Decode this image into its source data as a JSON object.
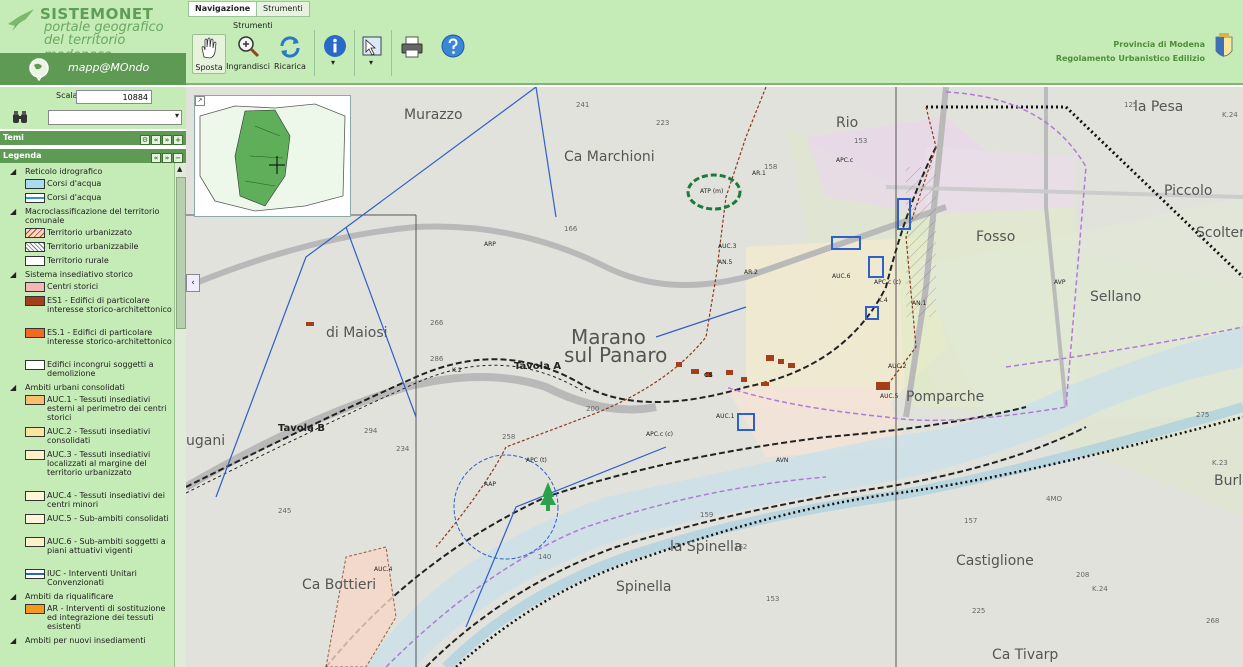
{
  "app": {
    "title": "SISTEMONET",
    "subtitle_line1": "portale geografico",
    "subtitle_line2": "del territorio modenese",
    "mappamondo": "mapp@MOndo"
  },
  "tabs": [
    {
      "label": "Navigazione",
      "active": true
    },
    {
      "label": "Strumenti",
      "active": false
    }
  ],
  "toolbar": {
    "group_label": "Strumenti",
    "sposta": "Sposta",
    "ingrandisci": "Ingrandisci",
    "ricarica": "Ricarica",
    "dropdown_arrow": "▾"
  },
  "province": {
    "line1": "Provincia di Modena",
    "line2": "Regolamento Urbanistico Edilizio"
  },
  "scale": {
    "label": "Scala",
    "value": "10884"
  },
  "panels": {
    "temi": "Temi",
    "legenda": "Legenda"
  },
  "legend": [
    {
      "type": "group",
      "label": "Reticolo idrografico"
    },
    {
      "type": "item",
      "label": "Corsi d'acqua",
      "fill": "#a9dcf0"
    },
    {
      "type": "item",
      "label": "Corsi d'acqua",
      "fill": "#ffffff",
      "line": "#3a8fd6"
    },
    {
      "type": "group",
      "label": "Macroclassificazione del territorio comunale"
    },
    {
      "type": "item",
      "label": "Territorio urbanizzato",
      "fill": "#f5d8c8",
      "pattern": "tri"
    },
    {
      "type": "item",
      "label": "Territorio urbanizzabile",
      "fill": "#ffffff",
      "pattern": "hatch"
    },
    {
      "type": "item",
      "label": "Territorio rurale",
      "fill": "#ffffff"
    },
    {
      "type": "group",
      "label": "Sistema insediativo storico"
    },
    {
      "type": "item",
      "label": "Centri storici",
      "fill": "#f5b6b6"
    },
    {
      "type": "item",
      "label": "ES1 - Edifici di particolare interesse storico-architettonico",
      "fill": "#a33f1a"
    },
    {
      "type": "item",
      "label": "ES.1 - Edifici di particolare interesse storico-architettonico",
      "fill": "#f26a21"
    },
    {
      "type": "item",
      "label": "Edifici incongrui soggetti a demolizione",
      "fill": "#ffffff"
    },
    {
      "type": "group",
      "label": "Ambiti urbani consolidati"
    },
    {
      "type": "item",
      "label": "AUC.1 - Tessuti insediativi esterni al perimetro dei centri storici",
      "fill": "#f8c06a"
    },
    {
      "type": "item",
      "label": "AUC.2 - Tessuti insediativi consolidati",
      "fill": "#fbe59e"
    },
    {
      "type": "item",
      "label": "AUC.3 - Tessuti insediativi localizzati al margine del territorio urbanizzato",
      "fill": "#fdf0c6"
    },
    {
      "type": "item",
      "label": "AUC.4 - Tessuti insediativi dei centri minori",
      "fill": "#fdf7d6"
    },
    {
      "type": "item",
      "label": "AUC.5 - Sub-ambiti consolidati",
      "fill": "#fef4dc"
    },
    {
      "type": "item",
      "label": "AUC.6 - Sub-ambiti soggetti a piani attuativi vigenti",
      "fill": "#fef0c8"
    },
    {
      "type": "item",
      "label": "IUC - Interventi Unitari Convenzionati",
      "fill": "#ffffff",
      "line": "#2f61c8"
    },
    {
      "type": "group",
      "label": "Ambiti da riqualificare"
    },
    {
      "type": "item",
      "label": "AR - Interventi di sostituzione ed integrazione dei tessuti esistenti",
      "fill": "#f39a1c"
    },
    {
      "type": "group",
      "label": "Ambiti per nuovi insediamenti"
    }
  ],
  "map": {
    "place_title_1": "Marano",
    "place_title_2": "sul Panaro",
    "tavola_a": "Tavola A",
    "tavola_b": "Tavola B",
    "labels": [
      "ATP (m)",
      "AR.1",
      "APC.c",
      "AUC.3",
      "AN.5",
      "AR.2",
      "AUC.6",
      "APC.c (c)",
      "AN.1",
      "AVP",
      "K.4",
      "AUC.2",
      "AUC.5",
      "CS",
      "AUC.1",
      "APC.c (c)",
      "APC (t)",
      "AAP",
      "AVN",
      "AUC.4",
      "ARP",
      "K.2"
    ],
    "topo_names": [
      "Murazzo",
      "Ca Marchioni",
      "di Maiosi",
      "Rio",
      "la Pesa",
      "Piccolo",
      "Scolter",
      "Fosso",
      "Sellano",
      "Pomparche",
      "Burle",
      "Castiglione",
      "la Spinella",
      "Spinella",
      "Ca Bottieri",
      "Ca Tivarp",
      "ugani",
      "4MO"
    ],
    "elevations": [
      "223",
      "166",
      "125",
      "241",
      "153",
      "158",
      "286",
      "266",
      "200",
      "258",
      "294",
      "234",
      "245",
      "140",
      "162",
      "159",
      "153",
      "157",
      "275",
      "225",
      "268",
      "208",
      "K.24",
      "K.23",
      "K.24"
    ]
  }
}
